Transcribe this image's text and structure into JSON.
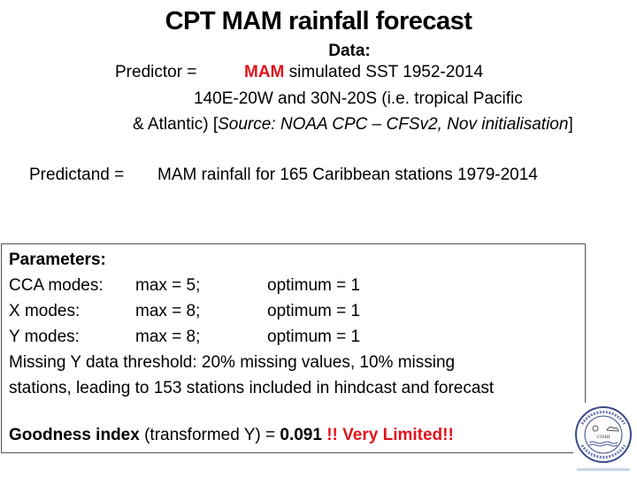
{
  "title": "CPT MAM rainfall forecast",
  "data_heading": "Data:",
  "predictor": {
    "label": "Predictor =",
    "highlight": "MAM",
    "line1_rest": "simulated SST 1952-2014",
    "line2": "140E-20W and 30N-20S (i.e. tropical Pacific",
    "line3_prefix": "& Atlantic) [",
    "line3_source": "Source: NOAA CPC – CFSv2, Nov initialisation",
    "line3_suffix": "]"
  },
  "predictand": {
    "label": "Predictand =",
    "value": "MAM rainfall  for 165 Caribbean stations 1979-2014"
  },
  "parameters": {
    "heading": "Parameters:",
    "rows": [
      {
        "name": "CCA modes:",
        "max": "max = 5;",
        "optimum": "optimum = 1"
      },
      {
        "name": "X modes:",
        "max": "max = 8;",
        "optimum": "optimum = 1"
      },
      {
        "name": "Y modes:",
        "max": "max = 8;",
        "optimum": "optimum = 1"
      }
    ],
    "missing_line1": "Missing Y data threshold: 20% missing values, 10% missing",
    "missing_line2": "stations, leading to 153 stations included in hindcast and forecast"
  },
  "goodness": {
    "label": "Goodness index",
    "detail": "(transformed Y) =",
    "value": "0.091",
    "verdict": "!! Very Limited!!"
  },
  "logo": {
    "name": "CIMH",
    "ring_text": "Caribbean Institute for Meteorology and Hydrology"
  },
  "colors": {
    "accent_red": "#e0141e",
    "border": "#555555"
  }
}
